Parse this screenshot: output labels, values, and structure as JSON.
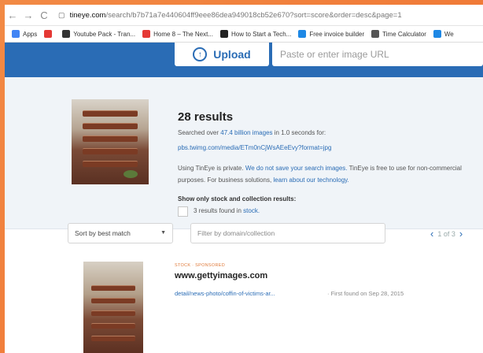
{
  "browser": {
    "url_host": "tineye.com",
    "url_path": "/search/b7b71a7e440604ff9eee86dea949018cb52e670?sort=score&order=desc&page=1"
  },
  "bookmarks": [
    {
      "label": "Apps",
      "color": "#4285f4"
    },
    {
      "label": "",
      "color": "#e53935"
    },
    {
      "label": "Youtube Pack - Tran...",
      "color": "#333333"
    },
    {
      "label": "Home 8 – The Next...",
      "color": "#e53935"
    },
    {
      "label": "How to Start a Tech...",
      "color": "#222222"
    },
    {
      "label": "Free invoice builder",
      "color": "#1e88e5"
    },
    {
      "label": "Time Calculator",
      "color": "#555555"
    },
    {
      "label": "We",
      "color": "#1e88e5"
    }
  ],
  "header": {
    "upload_label": "Upload",
    "url_placeholder": "Paste or enter image URL"
  },
  "results": {
    "count_title": "28 results",
    "searched_prefix": "Searched over ",
    "searched_count": "47.4 billion images",
    "searched_suffix": " in 1.0 seconds for:",
    "source_url": "pbs.twimg.com/media/ETm0nCjWsAEeEvy?format=jpg",
    "privacy_prefix": "Using TinEye is private. ",
    "privacy_link": "We do not save your search images.",
    "privacy_mid": " TinEye is free to use for non-commercial purposes. For business solutions, ",
    "privacy_link2": "learn about our technology.",
    "stock_heading": "Show only stock and collection results:",
    "stock_prefix": "3 results found in ",
    "stock_link": "stock."
  },
  "filters": {
    "sort_value": "Sort by best match",
    "filter_placeholder": "Filter by domain/collection",
    "page_text": "1 of 3"
  },
  "result_item": {
    "tag": "STOCK · SPONSORED",
    "domain": "www.gettyimages.com",
    "detail_link": "detail/news-photo/coffin-of-victims-ar...",
    "first_found": "· First found on Sep 28, 2015"
  }
}
